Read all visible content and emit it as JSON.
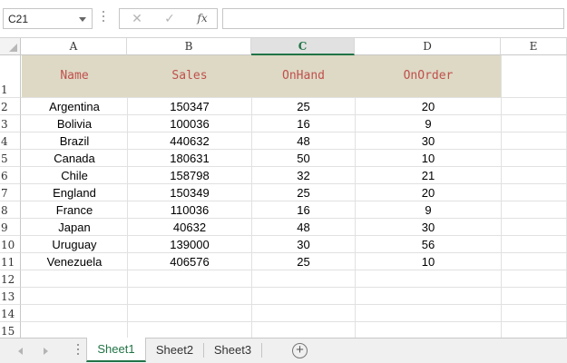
{
  "formula_bar": {
    "name_box": "C21",
    "cancel_icon": "✕",
    "enter_icon": "✓",
    "fx_label": "fx",
    "formula": ""
  },
  "columns": [
    "A",
    "B",
    "C",
    "D",
    "E"
  ],
  "selected_column": "C",
  "row_numbers": [
    "1",
    "2",
    "3",
    "4",
    "5",
    "6",
    "7",
    "8",
    "9",
    "10",
    "11",
    "12",
    "13",
    "14",
    "15"
  ],
  "table": {
    "headers": [
      "Name",
      "Sales",
      "OnHand",
      "OnOrder"
    ],
    "header_bg": "#ddd9c4",
    "header_color": "#c0504d",
    "rows": [
      [
        "Argentina",
        "150347",
        "25",
        "20"
      ],
      [
        "Bolivia",
        "100036",
        "16",
        "9"
      ],
      [
        "Brazil",
        "440632",
        "48",
        "30"
      ],
      [
        "Canada",
        "180631",
        "50",
        "10"
      ],
      [
        "Chile",
        "158798",
        "32",
        "21"
      ],
      [
        "England",
        "150349",
        "25",
        "20"
      ],
      [
        "France",
        "110036",
        "16",
        "9"
      ],
      [
        "Japan",
        "40632",
        "48",
        "30"
      ],
      [
        "Uruguay",
        "139000",
        "30",
        "56"
      ],
      [
        "Venezuela",
        "406576",
        "25",
        "10"
      ]
    ]
  },
  "sheets": {
    "tabs": [
      "Sheet1",
      "Sheet2",
      "Sheet3"
    ],
    "active": "Sheet1",
    "add_icon": "+"
  },
  "accent_color": "#217346"
}
